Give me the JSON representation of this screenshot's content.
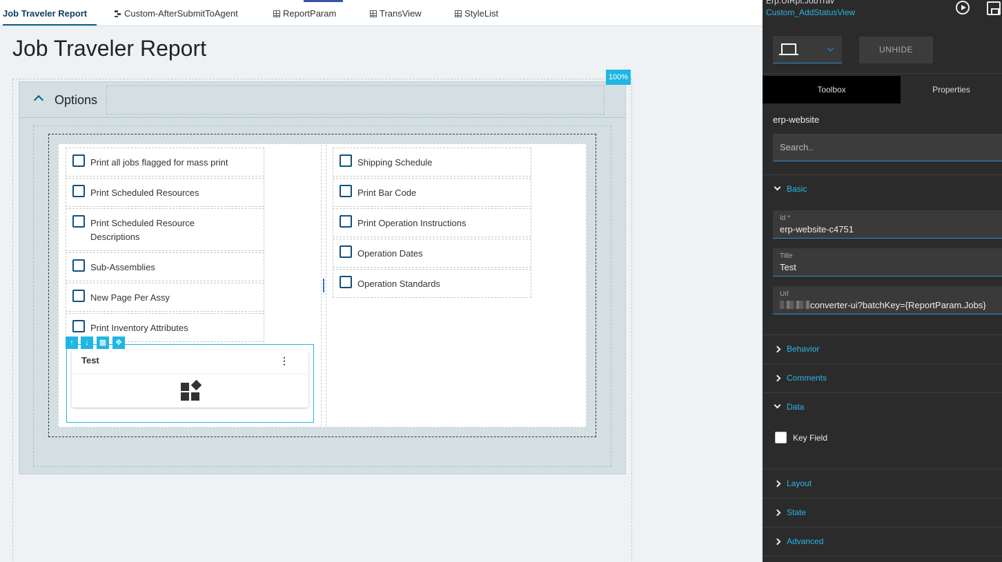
{
  "tabs": [
    {
      "label": "Job Traveler Report",
      "active": true
    },
    {
      "label": "Custom-AfterSubmitToAgent",
      "icon": "flow-icon"
    },
    {
      "label": "ReportParam",
      "icon": "grid-icon"
    },
    {
      "label": "TransView",
      "icon": "grid-icon"
    },
    {
      "label": "StyleList",
      "icon": "grid-icon"
    }
  ],
  "page": {
    "title": "Job Traveler Report",
    "zoom": "100%"
  },
  "options_panel": {
    "title": "Options"
  },
  "left_checkboxes": [
    {
      "label": "Print all jobs flagged for mass print",
      "checked": false
    },
    {
      "label": "Print Scheduled Resources",
      "checked": false
    },
    {
      "label": "Print Scheduled Resource Descriptions",
      "checked": false
    },
    {
      "label": "Sub-Assemblies",
      "checked": false
    },
    {
      "label": "New Page Per Assy",
      "checked": false
    },
    {
      "label": "Print Inventory Attributes",
      "checked": false
    }
  ],
  "right_checkboxes": [
    {
      "label": "Shipping Schedule",
      "checked": false
    },
    {
      "label": "Print Bar Code",
      "checked": false
    },
    {
      "label": "Print Operation Instructions",
      "checked": false
    },
    {
      "label": "Operation Dates",
      "checked": false
    },
    {
      "label": "Operation Standards",
      "checked": false
    }
  ],
  "widget": {
    "title": "Test",
    "menu_icon": "kebab-icon",
    "body_icon": "widgets-icon"
  },
  "selection_tools": [
    "arrow-up-icon",
    "arrow-down-icon",
    "delete-icon",
    "move-icon"
  ],
  "right_panel": {
    "breadcrumb": "Erp.UIRpt.JobTrav",
    "view_name": "Custom_AddStatusView",
    "device": "laptop-icon",
    "unhide_label": "UNHIDE",
    "tabs": {
      "toolbox": "Toolbox",
      "properties": "Properties"
    },
    "component": "erp-website",
    "search_placeholder": "Search..",
    "sections": {
      "basic": "Basic",
      "behavior": "Behavior",
      "comments": "Comments",
      "data": "Data",
      "layout": "Layout",
      "state": "State",
      "advanced": "Advanced"
    },
    "fields": {
      "id": {
        "label": "Id *",
        "value": "erp-website-c4751"
      },
      "title": {
        "label": "Title",
        "value": "Test"
      },
      "url": {
        "label": "Url",
        "value": "converter-ui?batchKey={ReportParam.Jobs}"
      }
    },
    "key_field": {
      "label": "Key Field",
      "checked": false
    }
  },
  "colors": {
    "accent": "#1fb6e3",
    "brand": "#0e5c8a",
    "link": "#2bb6e8",
    "panel_bg": "#2b2b2b"
  }
}
